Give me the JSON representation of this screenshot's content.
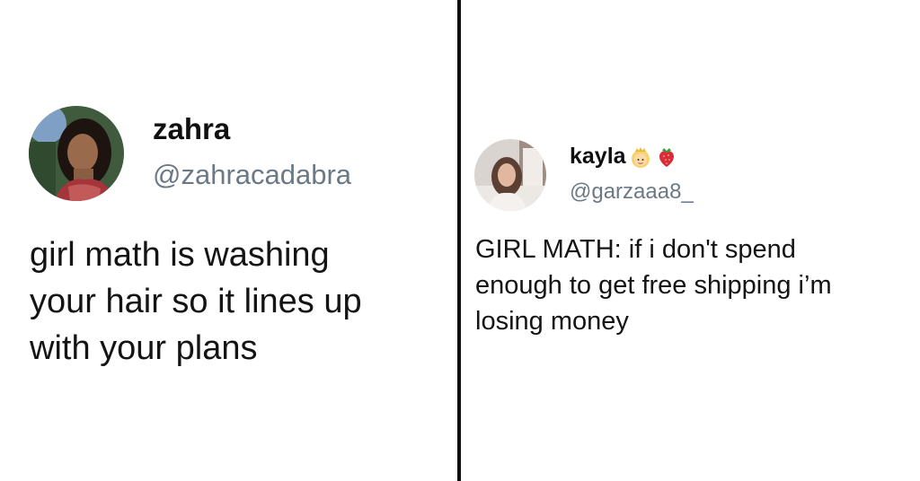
{
  "tweets": [
    {
      "name": "zahra",
      "handle": "@zahracadabra",
      "avatar_icon": "profile-photo",
      "lines": [
        "girl math is washing",
        "your hair so it lines up",
        "with your plans"
      ]
    },
    {
      "name": "kayla",
      "handle": "@garzaaa8_",
      "avatar_icon": "profile-photo",
      "name_emojis": [
        "princess-emoji",
        "strawberry-emoji"
      ],
      "lines": [
        "GIRL MATH: if i don't spend",
        "enough to get free shipping i’m",
        "losing money"
      ]
    }
  ],
  "colors": {
    "divider": "#0d0d0d",
    "handle": "#6b7986",
    "text": "#141414"
  }
}
